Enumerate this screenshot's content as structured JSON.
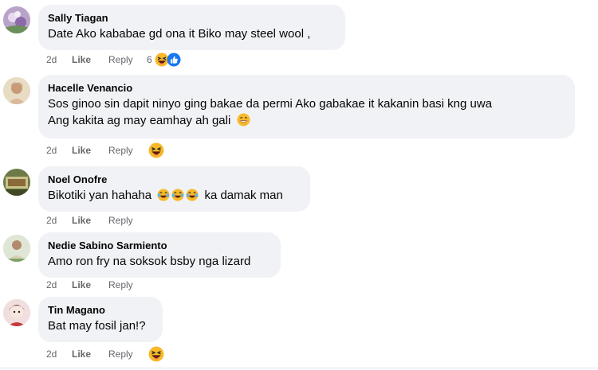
{
  "comments": [
    {
      "author": "Sally Tiagan",
      "text": "Date Ako kababae gd ona it Biko may steel wool ,",
      "time": "2d",
      "like": "Like",
      "reply": "Reply",
      "reaction_count": "6",
      "reactions": [
        "haha-icon",
        "like-icon"
      ]
    },
    {
      "author": "Hacelle Venancio",
      "line1": "Sos ginoo sin dapit ninyo ging bakae da permi Ako gabakae it kakanin basi kng uwa",
      "line2": "Ang kakita ag may eamhay ah gali",
      "time": "2d",
      "like": "Like",
      "reply": "Reply",
      "reactions": [
        "haha-icon"
      ]
    },
    {
      "author": "Noel Onofre",
      "text_before": "Bikotiki yan hahaha",
      "text_after": "ka damak man",
      "time": "2d",
      "like": "Like",
      "reply": "Reply"
    },
    {
      "author": "Nedie Sabino Sarmiento",
      "text": "Amo ron fry na soksok bsby nga lizard",
      "time": "2d",
      "like": "Like",
      "reply": "Reply"
    },
    {
      "author": "Tin Magano",
      "text": "Bat may fosil jan!?",
      "time": "2d",
      "like": "Like",
      "reply": "Reply",
      "reactions": [
        "haha-icon"
      ]
    }
  ],
  "colors": {
    "bubble": "#f0f2f5",
    "meta": "#65676b",
    "like_blue": "#1877f2",
    "haha_yellow": "#f7b928"
  }
}
